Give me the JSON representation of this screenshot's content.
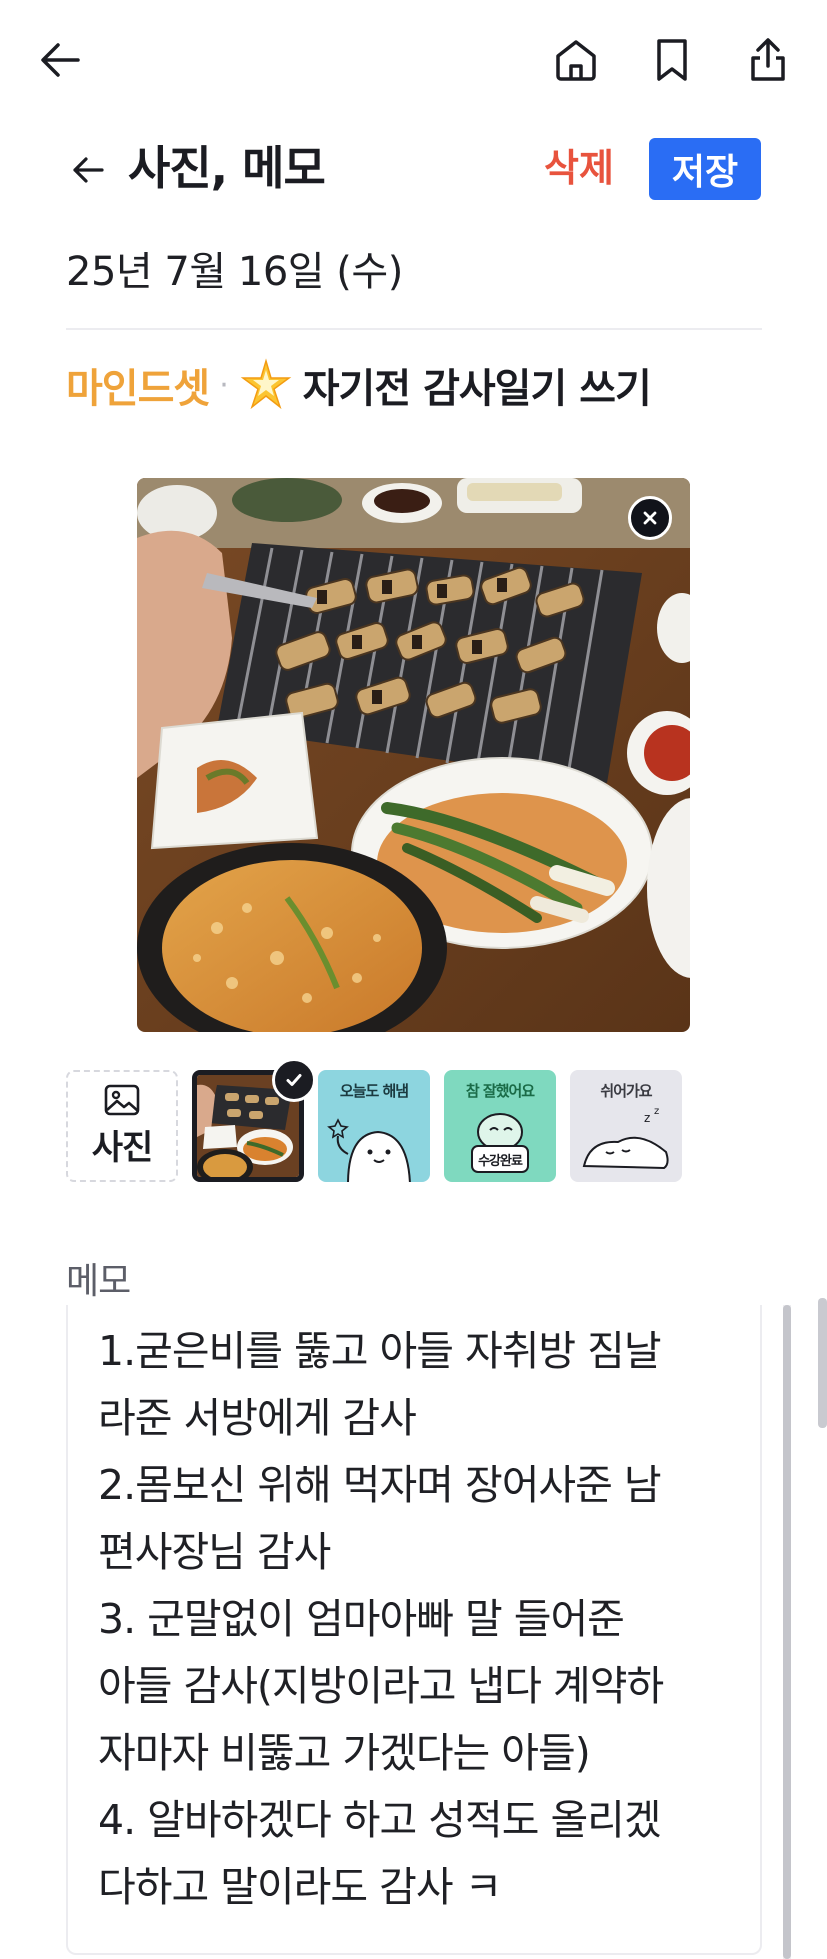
{
  "nav": {
    "back_icon": "arrow-left-icon",
    "home_icon": "home-icon",
    "bookmark_icon": "bookmark-icon",
    "share_icon": "share-icon"
  },
  "header": {
    "title": "사진, 메모",
    "delete_label": "삭제",
    "save_label": "저장"
  },
  "date": "25년 7월 16일 (수)",
  "mission": {
    "category": "마인드셋",
    "separator": "·",
    "emoji": "sparkle-star-icon",
    "title": "자기전 감사일기 쓰기"
  },
  "photo": {
    "close_icon": "close-icon"
  },
  "thumbnails": {
    "add_label": "사진",
    "stickers": [
      {
        "label": "오늘도 해냄"
      },
      {
        "label": "참 잘했어요",
        "sub": "수강완료"
      },
      {
        "label": "쉬어가요"
      }
    ]
  },
  "memo": {
    "label": "메모",
    "text": "1.굳은비를 뚫고 아들 자취방 짐날\n라준 서방에게 감사\n2.몸보신 위해 먹자며 장어사준 남\n편사장님 감사\n3. 군말없이 엄마아빠 말 들어준\n아들 감사(지방이라고 냅다 계약하\n자마자 비뚫고 가겠다는 아들)\n4. 알바하겠다 하고 성적도 올리겠\n다하고 말이라도 감사 ㅋ"
  },
  "colors": {
    "accent_blue": "#2a6df4",
    "delete_red": "#e8533d",
    "category_orange": "#efa33a"
  }
}
